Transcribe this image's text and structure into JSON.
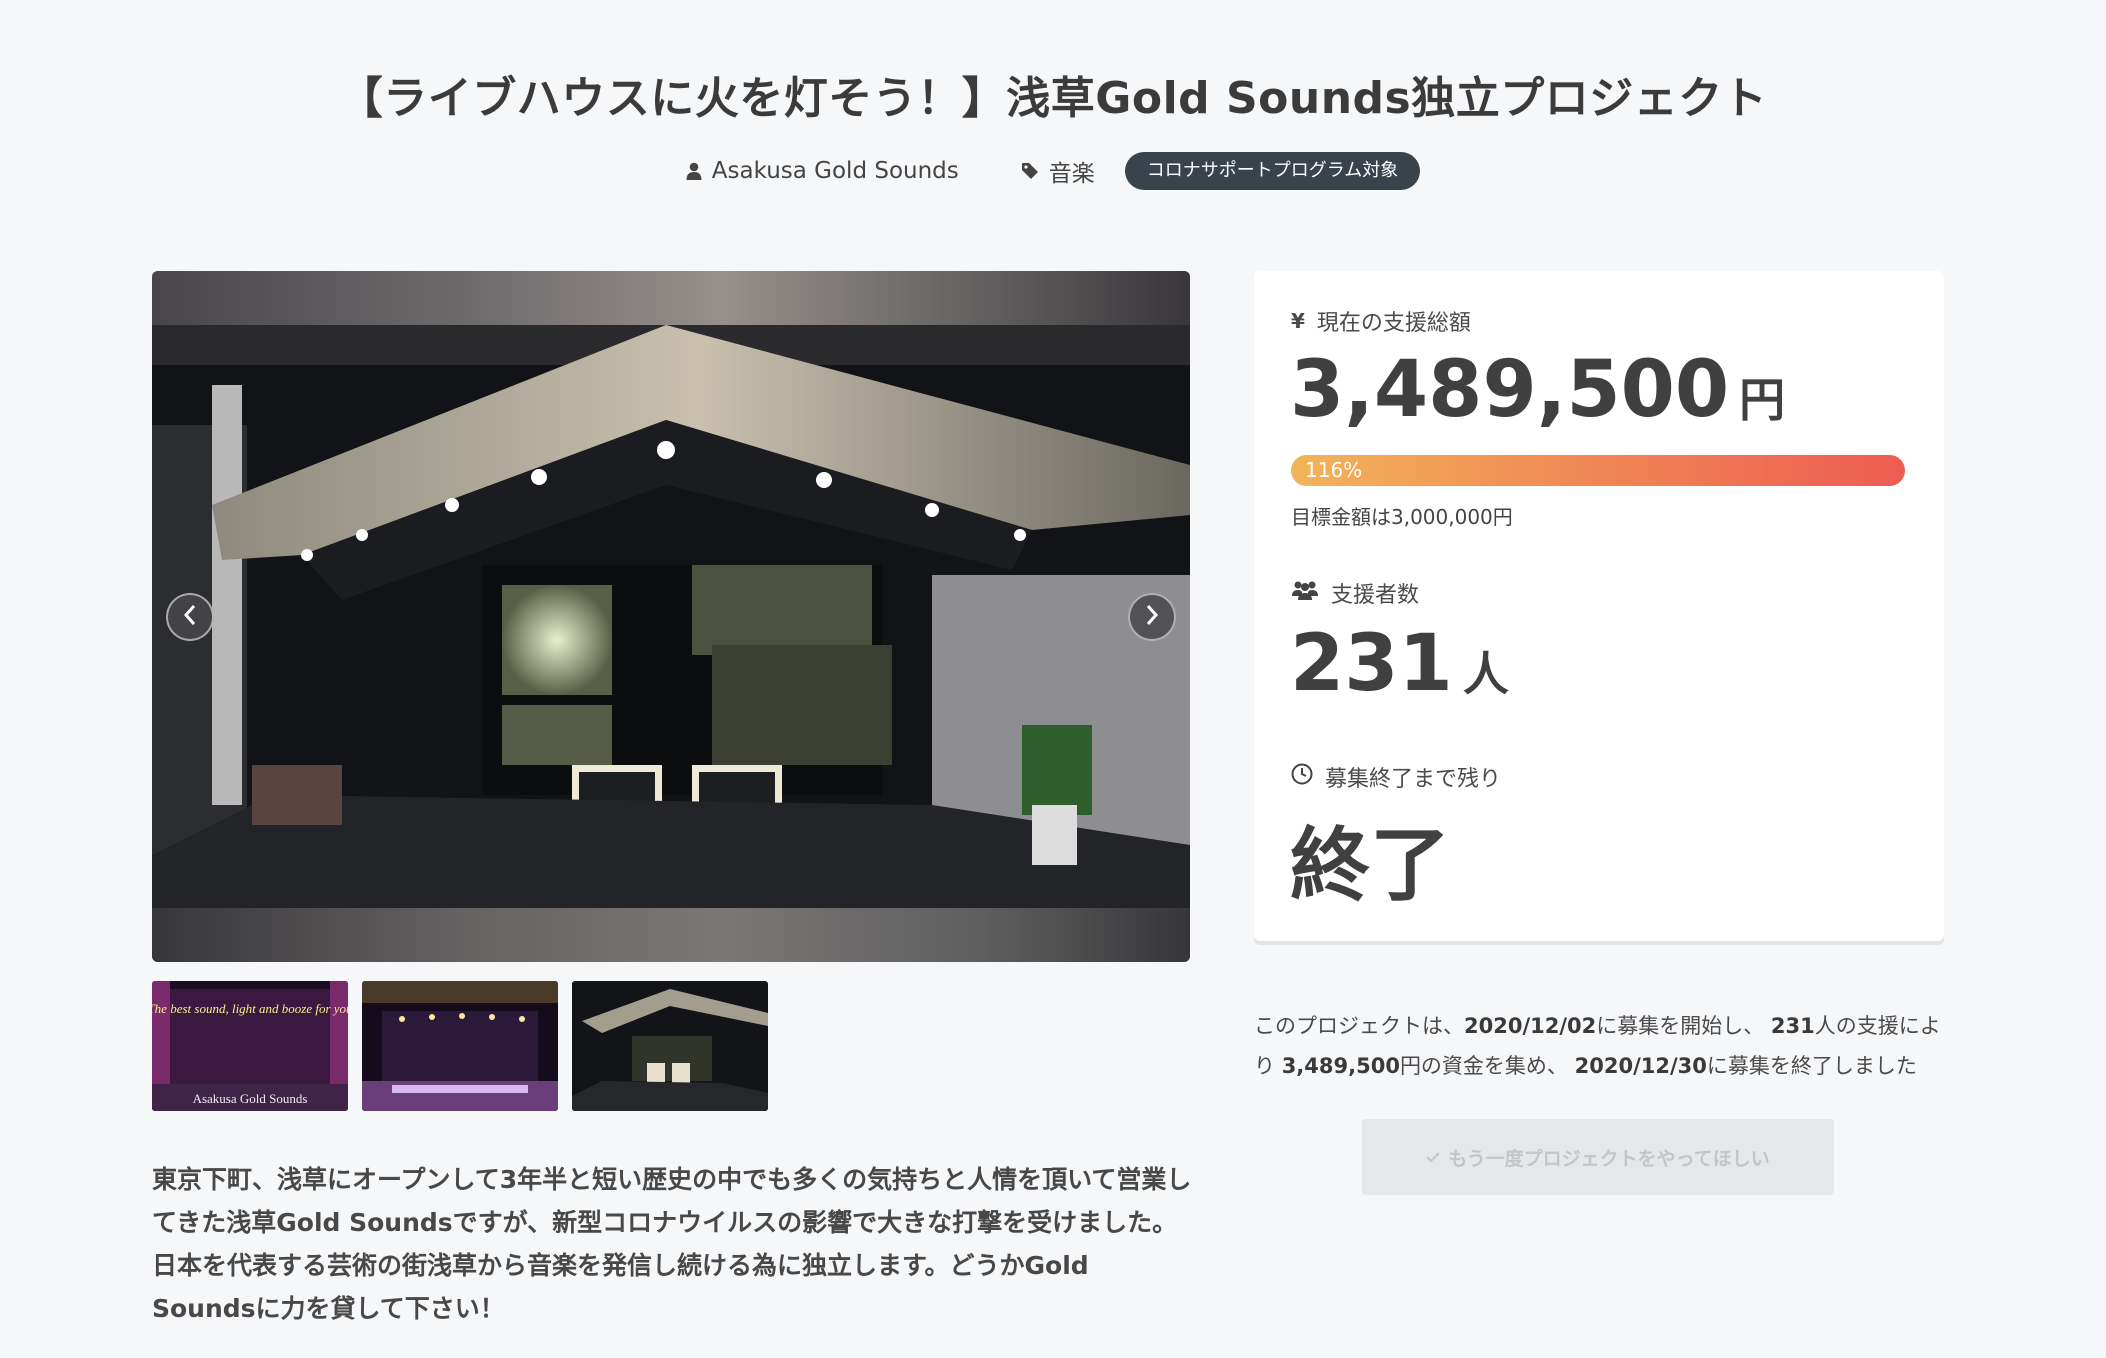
{
  "project": {
    "title": "【ライブハウスに火を灯そう！】浅草Gold Sounds独立プロジェクト",
    "owner": "Asakusa Gold Sounds",
    "category": "音楽",
    "badge": "コロナサポートプログラム対象"
  },
  "gallery": {
    "thumbs": [
      {
        "alt": "Asakusa Gold Sounds stage sign",
        "caption": "Asakusa Gold Sounds",
        "neon_text": "The best sound, light and booze for you"
      },
      {
        "alt": "stage with lights"
      },
      {
        "alt": "bar counter"
      }
    ]
  },
  "description": "東京下町、浅草にオープンして3年半と短い歴史の中でも多くの気持ちと人情を頂いて営業してきた浅草Gold Soundsですが、新型コロナウイルスの影響で大きな打撃を受けました。日本を代表する芸術の街浅草から音楽を発信し続ける為に独立します。どうかGold Soundsに力を貸して下さい！",
  "stats": {
    "amount_label": "現在の支援総額",
    "amount": "3,489,500",
    "amount_unit": "円",
    "progress_label": "116%",
    "progress_value": 1.16,
    "goal": "目標金額は3,000,000円",
    "backers_label": "支援者数",
    "backers": "231",
    "backers_unit": "人",
    "remaining_label": "募集終了まで残り",
    "remaining": "終了"
  },
  "summary": {
    "p1": "このプロジェクトは、",
    "start_date": "2020/12/02",
    "p2": "に募集を開始し、 ",
    "backers": "231",
    "p3": "人の支援により ",
    "amount": "3,489,500",
    "p4": "円の資金を集め、 ",
    "end_date": "2020/12/30",
    "p5": "に募集を終了しました"
  },
  "again_button": "もう一度プロジェクトをやってほしい",
  "colors": {
    "badge_bg": "#3a424c",
    "progress_start": "#f2b45a",
    "progress_end": "#ee5c52",
    "page_bg": "#f6f7f9"
  }
}
